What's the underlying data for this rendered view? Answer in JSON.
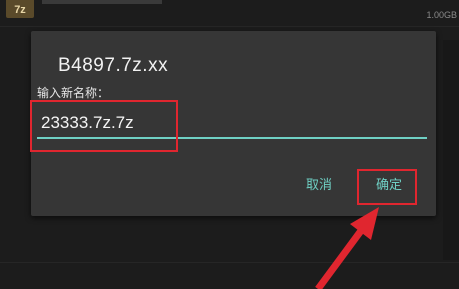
{
  "background": {
    "app_icon_label": "7z",
    "size_text": "1.00GB"
  },
  "dialog": {
    "title": "B4897.7z.xx",
    "field_label": "输入新名称：",
    "input_value": "23333.7z.7z",
    "cancel_label": "取消",
    "ok_label": "确定"
  },
  "colors": {
    "accent": "#6fd0c4",
    "annotation": "#e0262f",
    "dialog_bg": "#363636",
    "screen_bg": "#1c1c1c"
  }
}
